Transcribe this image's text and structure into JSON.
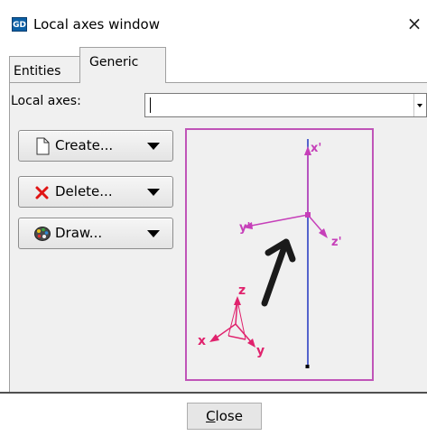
{
  "window": {
    "app_icon_text": "GD",
    "title": "Local axes window",
    "close_glyph": "×"
  },
  "tabs": [
    {
      "label": "Entities",
      "active": false
    },
    {
      "label": "Generic",
      "active": true
    }
  ],
  "local_axes": {
    "label": "Local axes:",
    "value": ""
  },
  "buttons": {
    "create": {
      "label": "Create...",
      "icon": "document-icon"
    },
    "delete": {
      "label": "Delete...",
      "icon": "red-x-icon"
    },
    "draw": {
      "label": "Draw...",
      "icon": "palette-icon"
    }
  },
  "preview": {
    "local_axes_labels": [
      "x'",
      "y'",
      "z'"
    ],
    "global_axes_labels": [
      "z",
      "x",
      "y"
    ],
    "colors": {
      "border": "#c054b8",
      "local_axes": "#c63fb9",
      "global_axes": "#e0226d",
      "vertical_line": "#2036c0",
      "arrow": "#1a1a1a"
    }
  },
  "footer": {
    "close_label_underlined": "C",
    "close_label_rest": "lose"
  }
}
